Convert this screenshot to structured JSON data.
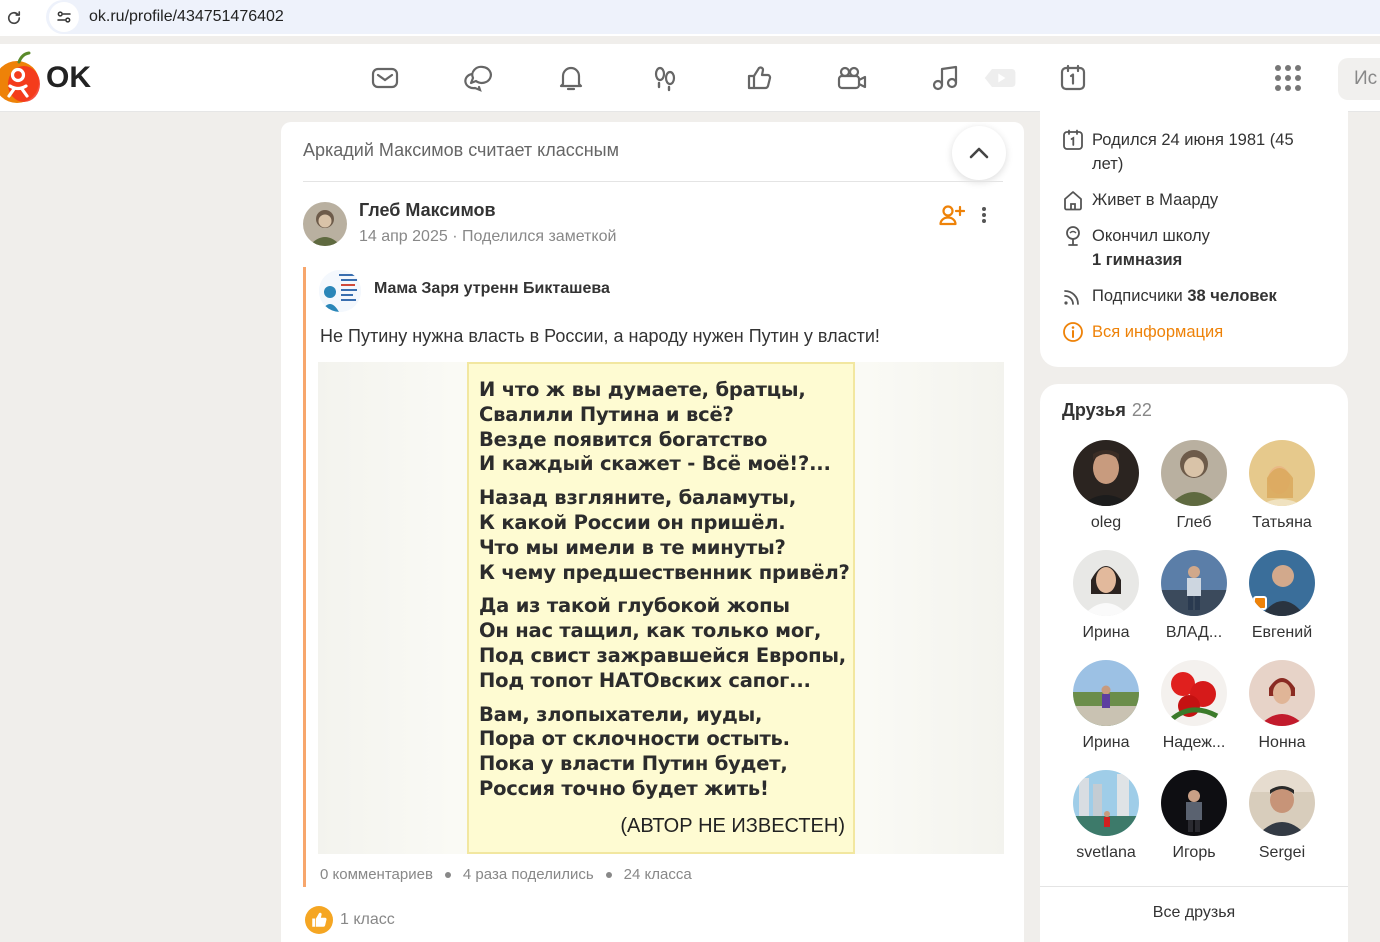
{
  "browser": {
    "url": "ok.ru/profile/434751476402"
  },
  "header": {
    "logo_text": "OK",
    "nav_icons": [
      "mail-icon",
      "discussions-icon",
      "notifications-icon",
      "guests-icon",
      "likes-icon",
      "video-icon",
      "music-icon",
      "clips-icon",
      "events-icon",
      "apps-grid-icon"
    ],
    "search_placeholder": "Ис"
  },
  "feed": {
    "liked_line": "Аркадий Максимов считает классным",
    "post": {
      "author": "Глеб Максимов",
      "date": "14 апр 2025",
      "action": "Поделился заметкой",
      "group_name": "Мама Заря утренн Бикташева",
      "text": "Не Путину нужна власть в России, а народу нужен Путин у власти!",
      "poem": [
        [
          "И что ж вы думаете, братцы,",
          "Свалили Путина и всё?",
          "Везде появится богатство",
          "И каждый скажет - Всё моё!?..."
        ],
        [
          "Назад взгляните, баламуты,",
          "К какой России он пришёл.",
          "Что мы имели в те минуты?",
          "К чему предшественник привёл?"
        ],
        [
          "Да из такой глубокой жопы",
          "Он нас тащил, как только мог,",
          "Под свист зажравшейся Европы,",
          "Под топот НАТОвских сапог..."
        ],
        [
          "Вам, злопыхатели, иуды,",
          "Пора от склочности остыть.",
          "Пока у власти Путин будет,",
          "Россия точно будет жить!"
        ]
      ],
      "poem_author": "(АВТОР НЕ ИЗВЕСТЕН)",
      "stats": {
        "comments": "0 комментариев",
        "shares": "4 раза поделились",
        "likes": "24 класса"
      },
      "my_like": "1 класс"
    }
  },
  "profile_info": {
    "birth": "Родился 24 июня 1981 (45",
    "birth_cont": "лет)",
    "lives": "Живет в Маарду",
    "school_label": "Окончил школу",
    "school_name": "1 гимназия",
    "followers_label": "Подписчики",
    "followers_value": "38 человек",
    "all_info": "Вся информация"
  },
  "friends": {
    "title": "Друзья",
    "count": "22",
    "list": [
      {
        "name": "oleg"
      },
      {
        "name": "Глеб"
      },
      {
        "name": "Татьяна"
      },
      {
        "name": "Ирина"
      },
      {
        "name": "ВЛАД..."
      },
      {
        "name": "Евгений"
      },
      {
        "name": "Ирина"
      },
      {
        "name": "Надеж..."
      },
      {
        "name": "Нонна"
      },
      {
        "name": "svetlana"
      },
      {
        "name": "Игорь"
      },
      {
        "name": "Sergei"
      }
    ],
    "all_friends": "Все друзья"
  },
  "colors": {
    "accent": "#ee8208",
    "page_bg": "#f0eeeb",
    "quote_bar": "#f7a66c",
    "poem_bg": "#fefbd2"
  }
}
